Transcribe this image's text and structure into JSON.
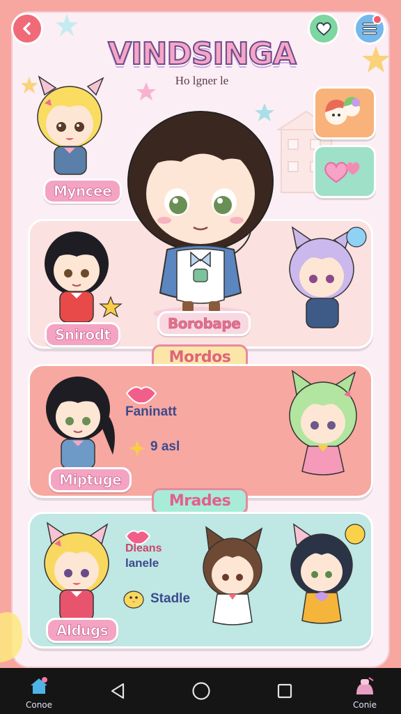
{
  "header": {
    "title": "VINDSINGA",
    "subtitle": "Ho lgner le"
  },
  "characters": {
    "top_left": "Myncee",
    "center": "Borobape",
    "panel1_left": "Snirodt",
    "panel2_left": "Miptuge",
    "panel3_left": "Aldugs"
  },
  "sections": {
    "section1": "Mordos",
    "section2": "Mrades"
  },
  "features": {
    "item1": "Faninatt",
    "item2": "9 asl",
    "item3_line1": "Dleans",
    "item3_line2": "lanele",
    "item4": "Stadle"
  },
  "nav": {
    "left_label": "Conoe",
    "right_label": "Conie"
  },
  "colors": {
    "background": "#f7a7a0",
    "frame": "#fbeef4",
    "panel1": "#fbe1e0",
    "panel2": "#f7a8a0",
    "panel3": "#bfe7e4",
    "nav": "#151515"
  }
}
